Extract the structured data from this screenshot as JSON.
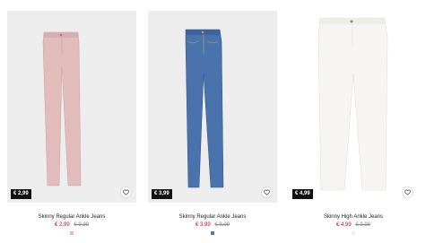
{
  "products": [
    {
      "name": "Skinny Regular Ankle Jeans",
      "tag_price": "€ 2,99",
      "price_now": "€ 2,99",
      "price_was": "€ 9,99",
      "color": "#e2bcbb",
      "swatch_color": "#e6b9bd"
    },
    {
      "name": "Skinny Regular Ankle Jeans",
      "tag_price": "€ 3,99",
      "price_now": "€ 3,99",
      "price_was": "€ 9,99",
      "color": "#4a73ad",
      "swatch_color": "#5479ad"
    },
    {
      "name": "Skinny High Ankle Jeans",
      "tag_price": "€ 4,99",
      "price_now": "€ 4,99",
      "price_was": "€ 9,99",
      "color": "#f7f5f2",
      "swatch_color": "#f2f2f2"
    }
  ],
  "icons": {
    "favorite": "heart-icon"
  }
}
